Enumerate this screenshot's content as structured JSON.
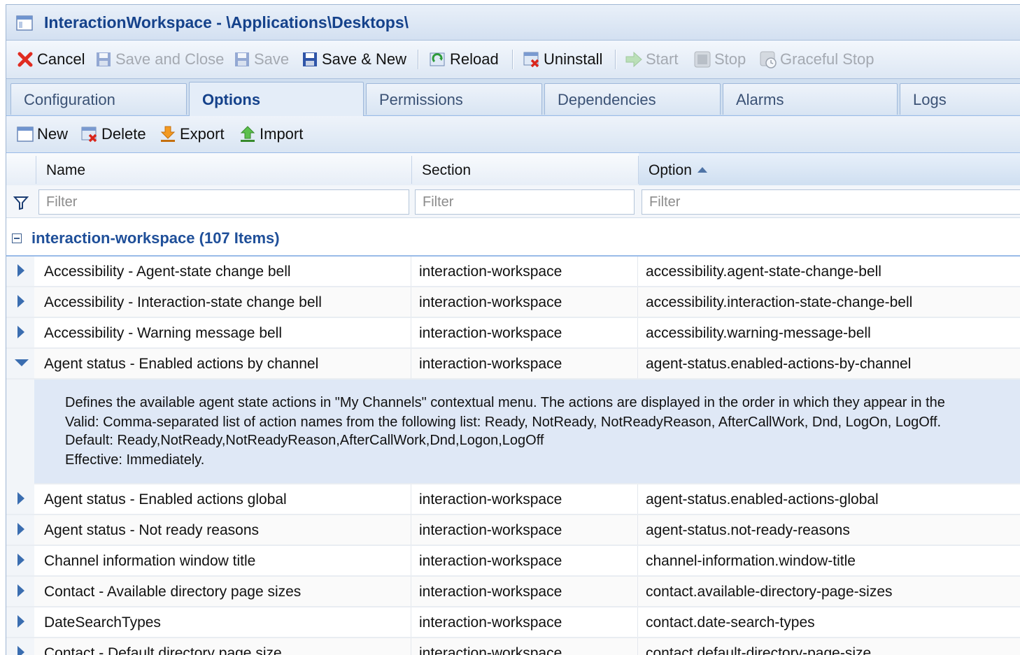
{
  "window": {
    "title": "InteractionWorkspace - \\Applications\\Desktops\\"
  },
  "toolbar": {
    "cancel": "Cancel",
    "save_close": "Save and Close",
    "save": "Save",
    "save_new": "Save & New",
    "reload": "Reload",
    "uninstall": "Uninstall",
    "start": "Start",
    "stop": "Stop",
    "graceful_stop": "Graceful Stop"
  },
  "tabs": [
    {
      "label": "Configuration"
    },
    {
      "label": "Options"
    },
    {
      "label": "Permissions"
    },
    {
      "label": "Dependencies"
    },
    {
      "label": "Alarms"
    },
    {
      "label": "Logs"
    }
  ],
  "grid_toolbar": {
    "new": "New",
    "delete": "Delete",
    "export": "Export",
    "import": "Import"
  },
  "columns": {
    "name": "Name",
    "section": "Section",
    "option": "Option"
  },
  "filter": {
    "placeholder": "Filter"
  },
  "group": {
    "label": "interaction-workspace (107 Items)"
  },
  "rows": [
    {
      "name": "Accessibility - Agent-state change bell",
      "section": "interaction-workspace",
      "option": "accessibility.agent-state-change-bell"
    },
    {
      "name": "Accessibility - Interaction-state change bell",
      "section": "interaction-workspace",
      "option": "accessibility.interaction-state-change-bell"
    },
    {
      "name": "Accessibility - Warning message bell",
      "section": "interaction-workspace",
      "option": "accessibility.warning-message-bell"
    },
    {
      "name": "Agent status - Enabled actions by channel",
      "section": "interaction-workspace",
      "option": "agent-status.enabled-actions-by-channel"
    },
    {
      "name": "Agent status - Enabled actions global",
      "section": "interaction-workspace",
      "option": "agent-status.enabled-actions-global"
    },
    {
      "name": "Agent status - Not ready reasons",
      "section": "interaction-workspace",
      "option": "agent-status.not-ready-reasons"
    },
    {
      "name": "Channel information window title",
      "section": "interaction-workspace",
      "option": "channel-information.window-title"
    },
    {
      "name": "Contact - Available directory page sizes",
      "section": "interaction-workspace",
      "option": "contact.available-directory-page-sizes"
    },
    {
      "name": "DateSearchTypes",
      "section": "interaction-workspace",
      "option": "contact.date-search-types"
    },
    {
      "name": "Contact - Default directory page size",
      "section": "interaction-workspace",
      "option": "contact.default-directory-page-size"
    }
  ],
  "detail": {
    "line1": "Defines the available agent state actions in \"My Channels\" contextual menu. The actions are displayed in the order in which they appear in the",
    "line2": "Valid: Comma-separated list of action names from the following list: Ready, NotReady, NotReadyReason, AfterCallWork, Dnd, LogOn, LogOff.",
    "line3": "Default: Ready,NotReady,NotReadyReason,AfterCallWork,Dnd,Logon,LogOff",
    "line4": "Effective: Immediately."
  }
}
